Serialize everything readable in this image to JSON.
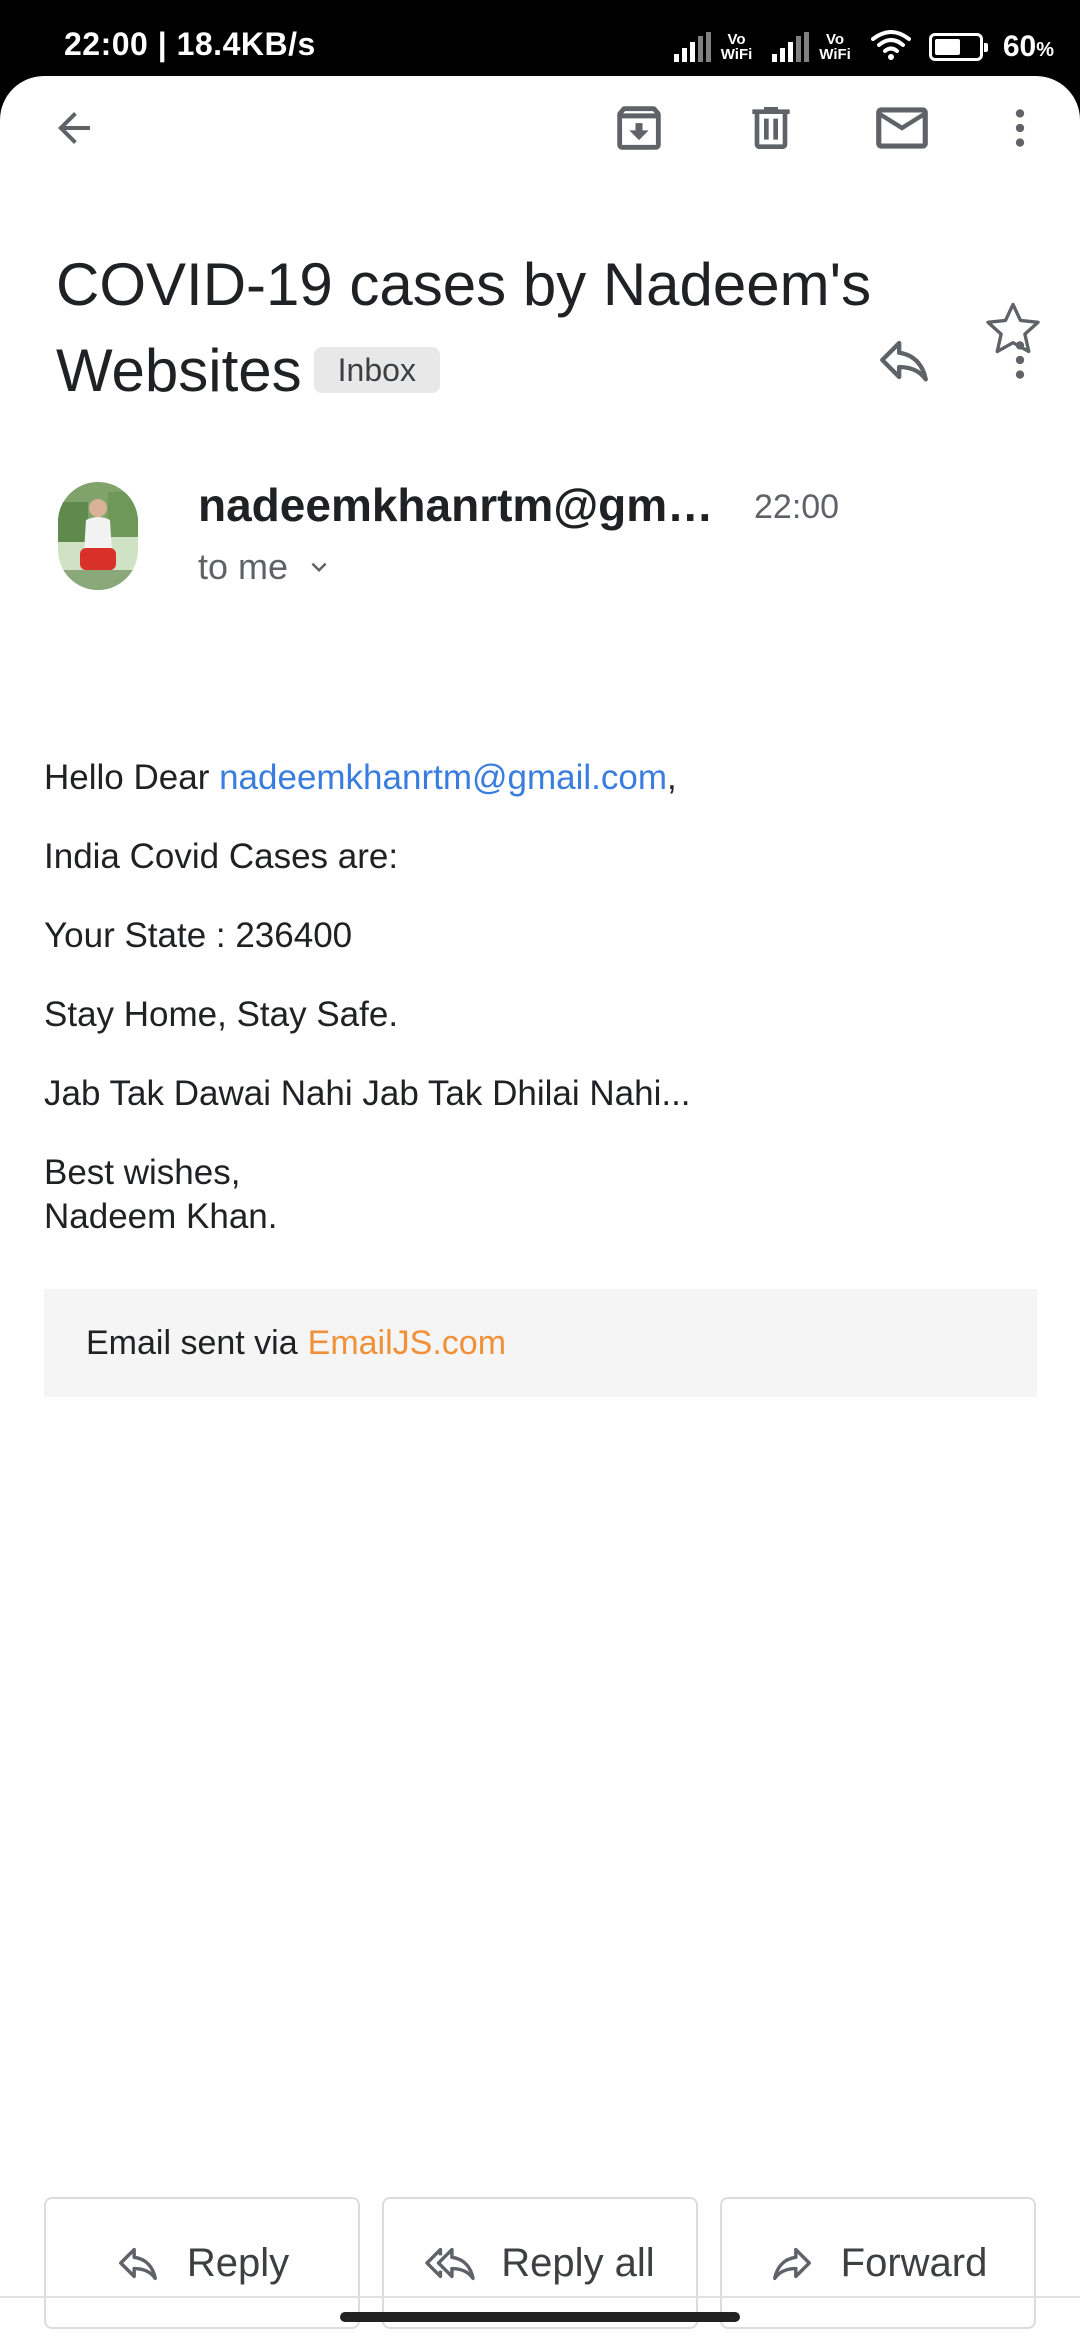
{
  "status_bar": {
    "time_speed": "22:00 | 18.4KB/s",
    "vowifi_top": "Vo",
    "vowifi_bottom": "WiFi",
    "battery_level": 0.6,
    "battery_percent": "60",
    "battery_unit": "%"
  },
  "toolbar": {
    "back_icon": "arrow-left-icon",
    "archive_icon": "archive-icon",
    "delete_icon": "trash-icon",
    "mark_unread_icon": "mail-icon",
    "more_icon": "more-vert-icon"
  },
  "email": {
    "subject": "COVID-19 cases by Nadeem's Websites",
    "label": "Inbox",
    "sender": "nadeemkhanrtm@gmail.com",
    "time": "22:00",
    "recipient_summary": "to me",
    "body": {
      "greeting_prefix": "Hello Dear ",
      "greeting_link": "nadeemkhanrtm@gmail.com",
      "greeting_suffix": ",",
      "line1": "India Covid Cases are:",
      "line2": "Your State : 236400",
      "line3": "Stay Home, Stay Safe.",
      "line4": "Jab Tak Dawai Nahi Jab Tak Dhilai Nahi...",
      "closing": "Best wishes,",
      "signature": "Nadeem Khan."
    },
    "footer_prefix": "Email sent via",
    "footer_link": "EmailJS.com"
  },
  "actions": {
    "reply": "Reply",
    "reply_all": "Reply all",
    "forward": "Forward"
  },
  "colors": {
    "link": "#3a7de0",
    "footer_link": "#f0913a",
    "icon": "#5f6368"
  }
}
